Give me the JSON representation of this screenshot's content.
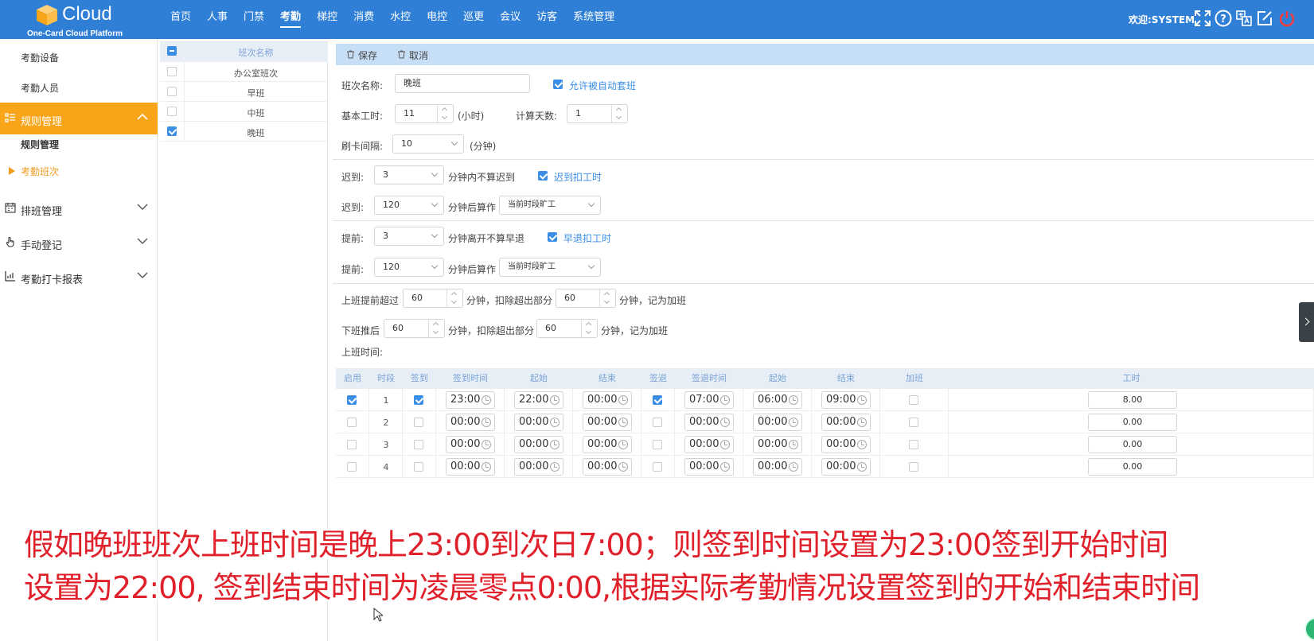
{
  "header": {
    "logo_text": "Cloud",
    "logo_sub": "One-Card Cloud Platform",
    "nav": [
      "首页",
      "人事",
      "门禁",
      "考勤",
      "梯控",
      "消费",
      "水控",
      "电控",
      "巡更",
      "会议",
      "访客",
      "系统管理"
    ],
    "active_nav": "考勤",
    "welcome": "欢迎:SYSTEM",
    "colors": {
      "header_bg": "#2f7fd6",
      "accent": "#f8a51a",
      "power_icon": "#ff3b3b"
    }
  },
  "sidebar": {
    "top_items": [
      "考勤设备",
      "考勤人员"
    ],
    "rules_group": "规则管理",
    "rules_sub": [
      "规则管理",
      "考勤班次"
    ],
    "groups": [
      "排班管理",
      "手动登记",
      "考勤打卡报表"
    ]
  },
  "shift_list": {
    "header": "班次名称",
    "rows": [
      {
        "name": "办公室班次",
        "checked": false
      },
      {
        "name": "早班",
        "checked": false
      },
      {
        "name": "中班",
        "checked": false
      },
      {
        "name": "晚班",
        "checked": true
      }
    ]
  },
  "toolbar": {
    "save": "保存",
    "cancel": "取消"
  },
  "form": {
    "name_label": "班次名称:",
    "name_value": "晚班",
    "auto_label": "允许被自动套班",
    "base_hours_label": "基本工时:",
    "base_hours_value": "11",
    "hours_unit": "(小时)",
    "calc_days_label": "计算天数:",
    "calc_days_value": "1",
    "interval_label": "刷卡间隔:",
    "interval_value": "10",
    "interval_unit": "(分钟)",
    "late1_label": "迟到:",
    "late1_value": "3",
    "late1_text": "分钟内不算迟到",
    "late1_check": "迟到扣工时",
    "late2_label": "迟到:",
    "late2_value": "120",
    "late2_text": "分钟后算作",
    "late2_select": "当前时段旷工",
    "early1_label": "提前:",
    "early1_value": "3",
    "early1_text": "分钟离开不算早退",
    "early1_check": "早退扣工时",
    "early2_label": "提前:",
    "early2_value": "120",
    "early2_text": "分钟后算作",
    "early2_select": "当前时段旷工",
    "ot1_label": "上班提前超过",
    "ot1_value": "60",
    "ot1_mid": "分钟，扣除超出部分",
    "ot1_value2": "60",
    "ot1_end": "分钟，记为加班",
    "ot2_label": "下班推后",
    "ot2_value": "60",
    "ot2_mid": "分钟，扣除超出部分",
    "ot2_value2": "60",
    "ot2_end": "分钟，记为加班",
    "work_time_label": "上班时间:"
  },
  "table": {
    "headers": [
      "启用",
      "时段",
      "签到",
      "签到时间",
      "起始",
      "结束",
      "签退",
      "签退时间",
      "起始",
      "结束",
      "加班",
      "工时"
    ],
    "rows": [
      {
        "enabled": true,
        "period": "1",
        "signin": true,
        "signin_time": "23:00",
        "start": "22:00",
        "end": "00:00",
        "signout": true,
        "signout_time": "07:00",
        "out_start": "06:00",
        "out_end": "09:00",
        "overtime": false,
        "hours": "8.00"
      },
      {
        "enabled": false,
        "period": "2",
        "signin": false,
        "signin_time": "00:00",
        "start": "00:00",
        "end": "00:00",
        "signout": false,
        "signout_time": "00:00",
        "out_start": "00:00",
        "out_end": "00:00",
        "overtime": false,
        "hours": "0.00"
      },
      {
        "enabled": false,
        "period": "3",
        "signin": false,
        "signin_time": "00:00",
        "start": "00:00",
        "end": "00:00",
        "signout": false,
        "signout_time": "00:00",
        "out_start": "00:00",
        "out_end": "00:00",
        "overtime": false,
        "hours": "0.00"
      },
      {
        "enabled": false,
        "period": "4",
        "signin": false,
        "signin_time": "00:00",
        "start": "00:00",
        "end": "00:00",
        "signout": false,
        "signout_time": "00:00",
        "out_start": "00:00",
        "out_end": "00:00",
        "overtime": false,
        "hours": "0.00"
      }
    ]
  },
  "caption": {
    "line1": "假如晚班班次上班时间是晚上23:00到次日7:00；则签到时间设置为23:00签到开始时间",
    "line2": "设置为22:00, 签到结束时间为凌晨零点0:00,根据实际考勤情况设置签到的开始和结束时间"
  }
}
